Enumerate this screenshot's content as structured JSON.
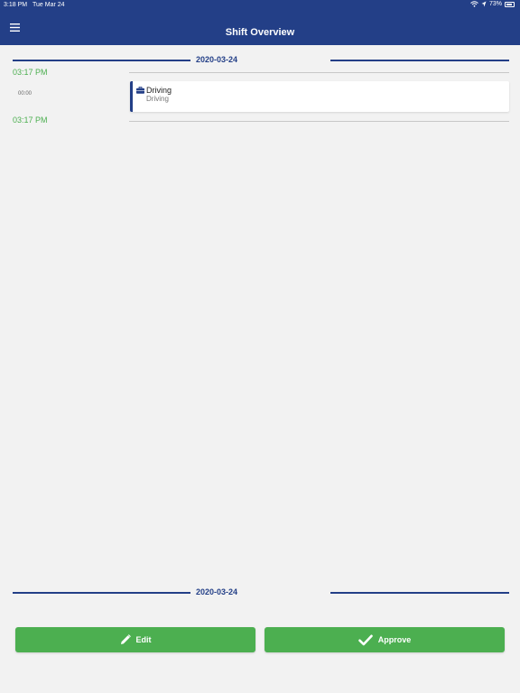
{
  "status_bar": {
    "time": "3:18 PM",
    "date": "Tue Mar 24",
    "battery": "73%"
  },
  "header": {
    "title": "Shift Overview",
    "menu_icon": "hamburger-menu-icon"
  },
  "top_divider": {
    "date": "2020-03-24"
  },
  "timeline": {
    "start_time": "03:17 PM",
    "duration": "00:00",
    "end_time": "03:17 PM"
  },
  "entry": {
    "icon": "briefcase-icon",
    "title": "Driving",
    "subtitle": "Driving"
  },
  "bottom_divider": {
    "date": "2020-03-24"
  },
  "actions": {
    "edit_label": "Edit",
    "approve_label": "Approve"
  },
  "colors": {
    "primary": "#233f87",
    "accent_green": "#4caf50",
    "background": "#f2f2f2"
  }
}
